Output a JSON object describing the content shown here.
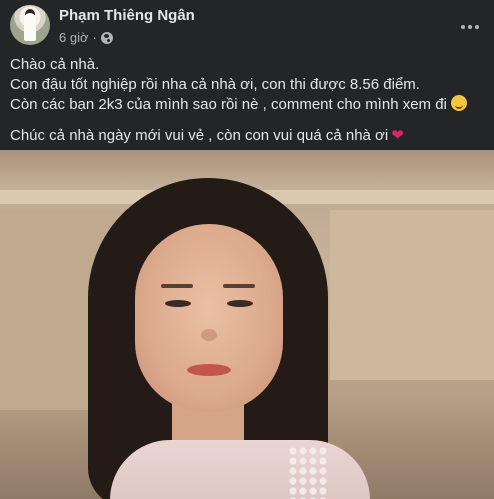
{
  "post": {
    "author": "Phạm Thiêng Ngân",
    "time": "6 giờ",
    "separator": "·",
    "privacy_icon": "globe-icon",
    "more_icon": "more-options-icon",
    "lines": [
      "Chào cả nhà.",
      "Con đậu tốt nghiệp rồi nha cả nhà ơi, con thi được 8.56  điểm.",
      "Còn các bạn 2k3 của mình sao rồi nè , comment cho mình xem đi",
      "Chúc cả nhà ngày mới vui vẻ , còn con vui quá cả nhà ơi"
    ],
    "emoji": {
      "line3": "smiling-face-emoji",
      "line4": "red-heart-emoji"
    }
  },
  "colors": {
    "background": "#242526",
    "primary_text": "#e4e6eb",
    "secondary_text": "#b0b3b8",
    "heart": "#e0245e"
  }
}
